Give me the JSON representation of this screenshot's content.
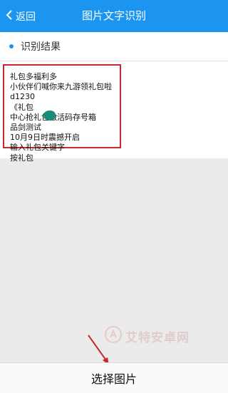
{
  "header": {
    "back_label": "返回",
    "title": "图片文字识别"
  },
  "section": {
    "label": "识别结果"
  },
  "result": {
    "lines": [
      "礼包多福利多",
      "小伙伴们喊你来九游领礼包啦",
      "d1230",
      "《礼包",
      "中心抢礼包激活码存号箱",
      "品剑测试",
      "10月9日时震撼开启",
      "输入礼包关键字",
      "按礼包"
    ]
  },
  "watermark": {
    "text": "艾特安卓网"
  },
  "footer": {
    "button_label": "选择图片"
  },
  "colors": {
    "header_bg": "#1b95f0",
    "highlight_border": "#c8292f",
    "arrow": "#c8292f"
  }
}
